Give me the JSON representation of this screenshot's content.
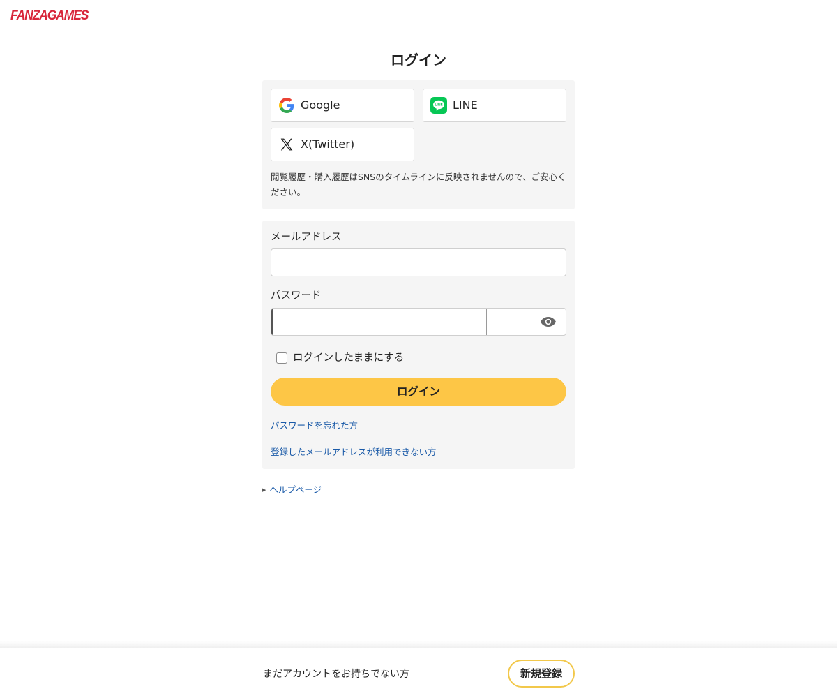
{
  "header": {
    "logo_text": "FANZAGAMES"
  },
  "page": {
    "title": "ログイン"
  },
  "sns": {
    "buttons": [
      {
        "label": "Google",
        "icon": "google-icon"
      },
      {
        "label": "LINE",
        "icon": "line-icon"
      },
      {
        "label": "X(Twitter)",
        "icon": "x-twitter-icon"
      }
    ],
    "note": "閲覧履歴・購入履歴はSNSのタイムラインに反映されませんので、ご安心ください。"
  },
  "form": {
    "email_label": "メールアドレス",
    "email_value": "",
    "password_label": "パスワード",
    "password_value": "",
    "show_password_icon": "eye-icon",
    "remember_label": "ログインしたままにする",
    "remember_checked": false,
    "login_button": "ログイン",
    "forgot_link": "パスワードを忘れた方",
    "email_unavailable_link": "登録したメールアドレスが利用できない方"
  },
  "help": {
    "label": "ヘルプページ"
  },
  "footer": {
    "prompt": "まだアカウントをお持ちでない方",
    "register_button": "新規登録"
  },
  "colors": {
    "brand_red": "#d8263a",
    "login_button_yellow": "#fdc646",
    "link_blue": "#1a5aa8",
    "panel_gray": "#f5f5f5",
    "line_green": "#06c755"
  }
}
